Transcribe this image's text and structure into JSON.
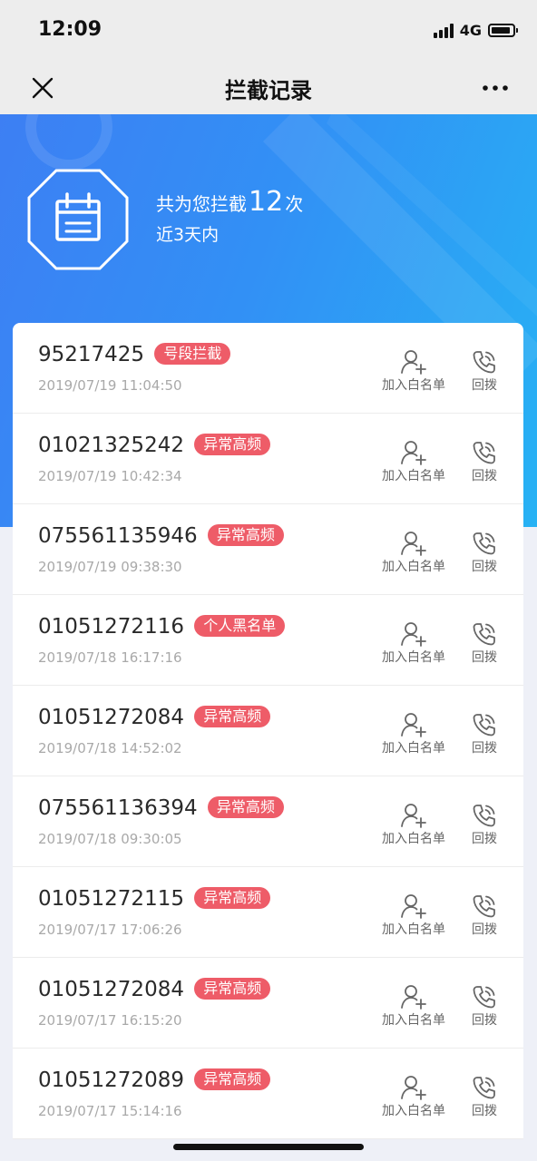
{
  "status_bar": {
    "time": "12:09",
    "network": "4G",
    "signal_icon": "signal-bars-icon",
    "battery_icon": "battery-icon"
  },
  "nav": {
    "title": "拦截记录",
    "close_icon": "close-icon",
    "more_icon": "more-dots-icon"
  },
  "summary": {
    "prefix": "共为您拦截",
    "count": "12",
    "suffix": "次",
    "period": "近3天内",
    "emblem_icon": "calendar-shield-icon"
  },
  "actions": {
    "whitelist_label": "加入白名单",
    "callback_label": "回拨",
    "whitelist_icon": "add-user-icon",
    "callback_icon": "phone-callback-icon"
  },
  "colors": {
    "hero_start": "#3d7ff3",
    "hero_end": "#27b2f4",
    "tag": "#ee5c68"
  },
  "records": [
    {
      "number": "95217425",
      "tag": "号段拦截",
      "time": "2019/07/19 11:04:50"
    },
    {
      "number": "01021325242",
      "tag": "异常高频",
      "time": "2019/07/19 10:42:34"
    },
    {
      "number": "075561135946",
      "tag": "异常高频",
      "time": "2019/07/19 09:38:30"
    },
    {
      "number": "01051272116",
      "tag": "个人黑名单",
      "time": "2019/07/18 16:17:16"
    },
    {
      "number": "01051272084",
      "tag": "异常高频",
      "time": "2019/07/18 14:52:02"
    },
    {
      "number": "075561136394",
      "tag": "异常高频",
      "time": "2019/07/18 09:30:05"
    },
    {
      "number": "01051272115",
      "tag": "异常高频",
      "time": "2019/07/17 17:06:26"
    },
    {
      "number": "01051272084",
      "tag": "异常高频",
      "time": "2019/07/17 16:15:20"
    },
    {
      "number": "01051272089",
      "tag": "异常高频",
      "time": "2019/07/17 15:14:16"
    }
  ]
}
